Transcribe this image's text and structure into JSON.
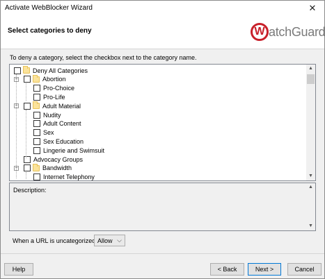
{
  "window": {
    "title": "Activate WebBlocker Wizard",
    "close_glyph": "✕"
  },
  "header": {
    "heading": "Select categories to deny",
    "logo_mark": "W",
    "logo_text": "atchGuard"
  },
  "instruction": "To deny a category, select the checkbox next to the category name.",
  "tree": {
    "items": [
      {
        "label": "Deny All Categories",
        "level": 0,
        "folder": true
      },
      {
        "label": "Abortion",
        "level": 1,
        "folder": true,
        "expander": "−"
      },
      {
        "label": "Pro-Choice",
        "level": 2,
        "folder": false
      },
      {
        "label": "Pro-Life",
        "level": 2,
        "folder": false
      },
      {
        "label": "Adult Material",
        "level": 1,
        "folder": true,
        "expander": "−"
      },
      {
        "label": "Nudity",
        "level": 2,
        "folder": false
      },
      {
        "label": "Adult Content",
        "level": 2,
        "folder": false
      },
      {
        "label": "Sex",
        "level": 2,
        "folder": false
      },
      {
        "label": "Sex Education",
        "level": 2,
        "folder": false
      },
      {
        "label": "Lingerie and Swimsuit",
        "level": 2,
        "folder": false
      },
      {
        "label": "Advocacy Groups",
        "level": 1,
        "folder": false
      },
      {
        "label": "Bandwidth",
        "level": 1,
        "folder": true,
        "expander": "−"
      },
      {
        "label": "Internet Telephony",
        "level": 2,
        "folder": false
      }
    ],
    "scroll_up": "▲",
    "scroll_down": "▼"
  },
  "description": {
    "label": "Description:"
  },
  "uncategorized": {
    "label": "When a URL is uncategorized",
    "value": "Allow",
    "caret": "⌵"
  },
  "buttons": {
    "help": "Help",
    "back": "< Back",
    "next": "Next >",
    "cancel": "Cancel"
  }
}
